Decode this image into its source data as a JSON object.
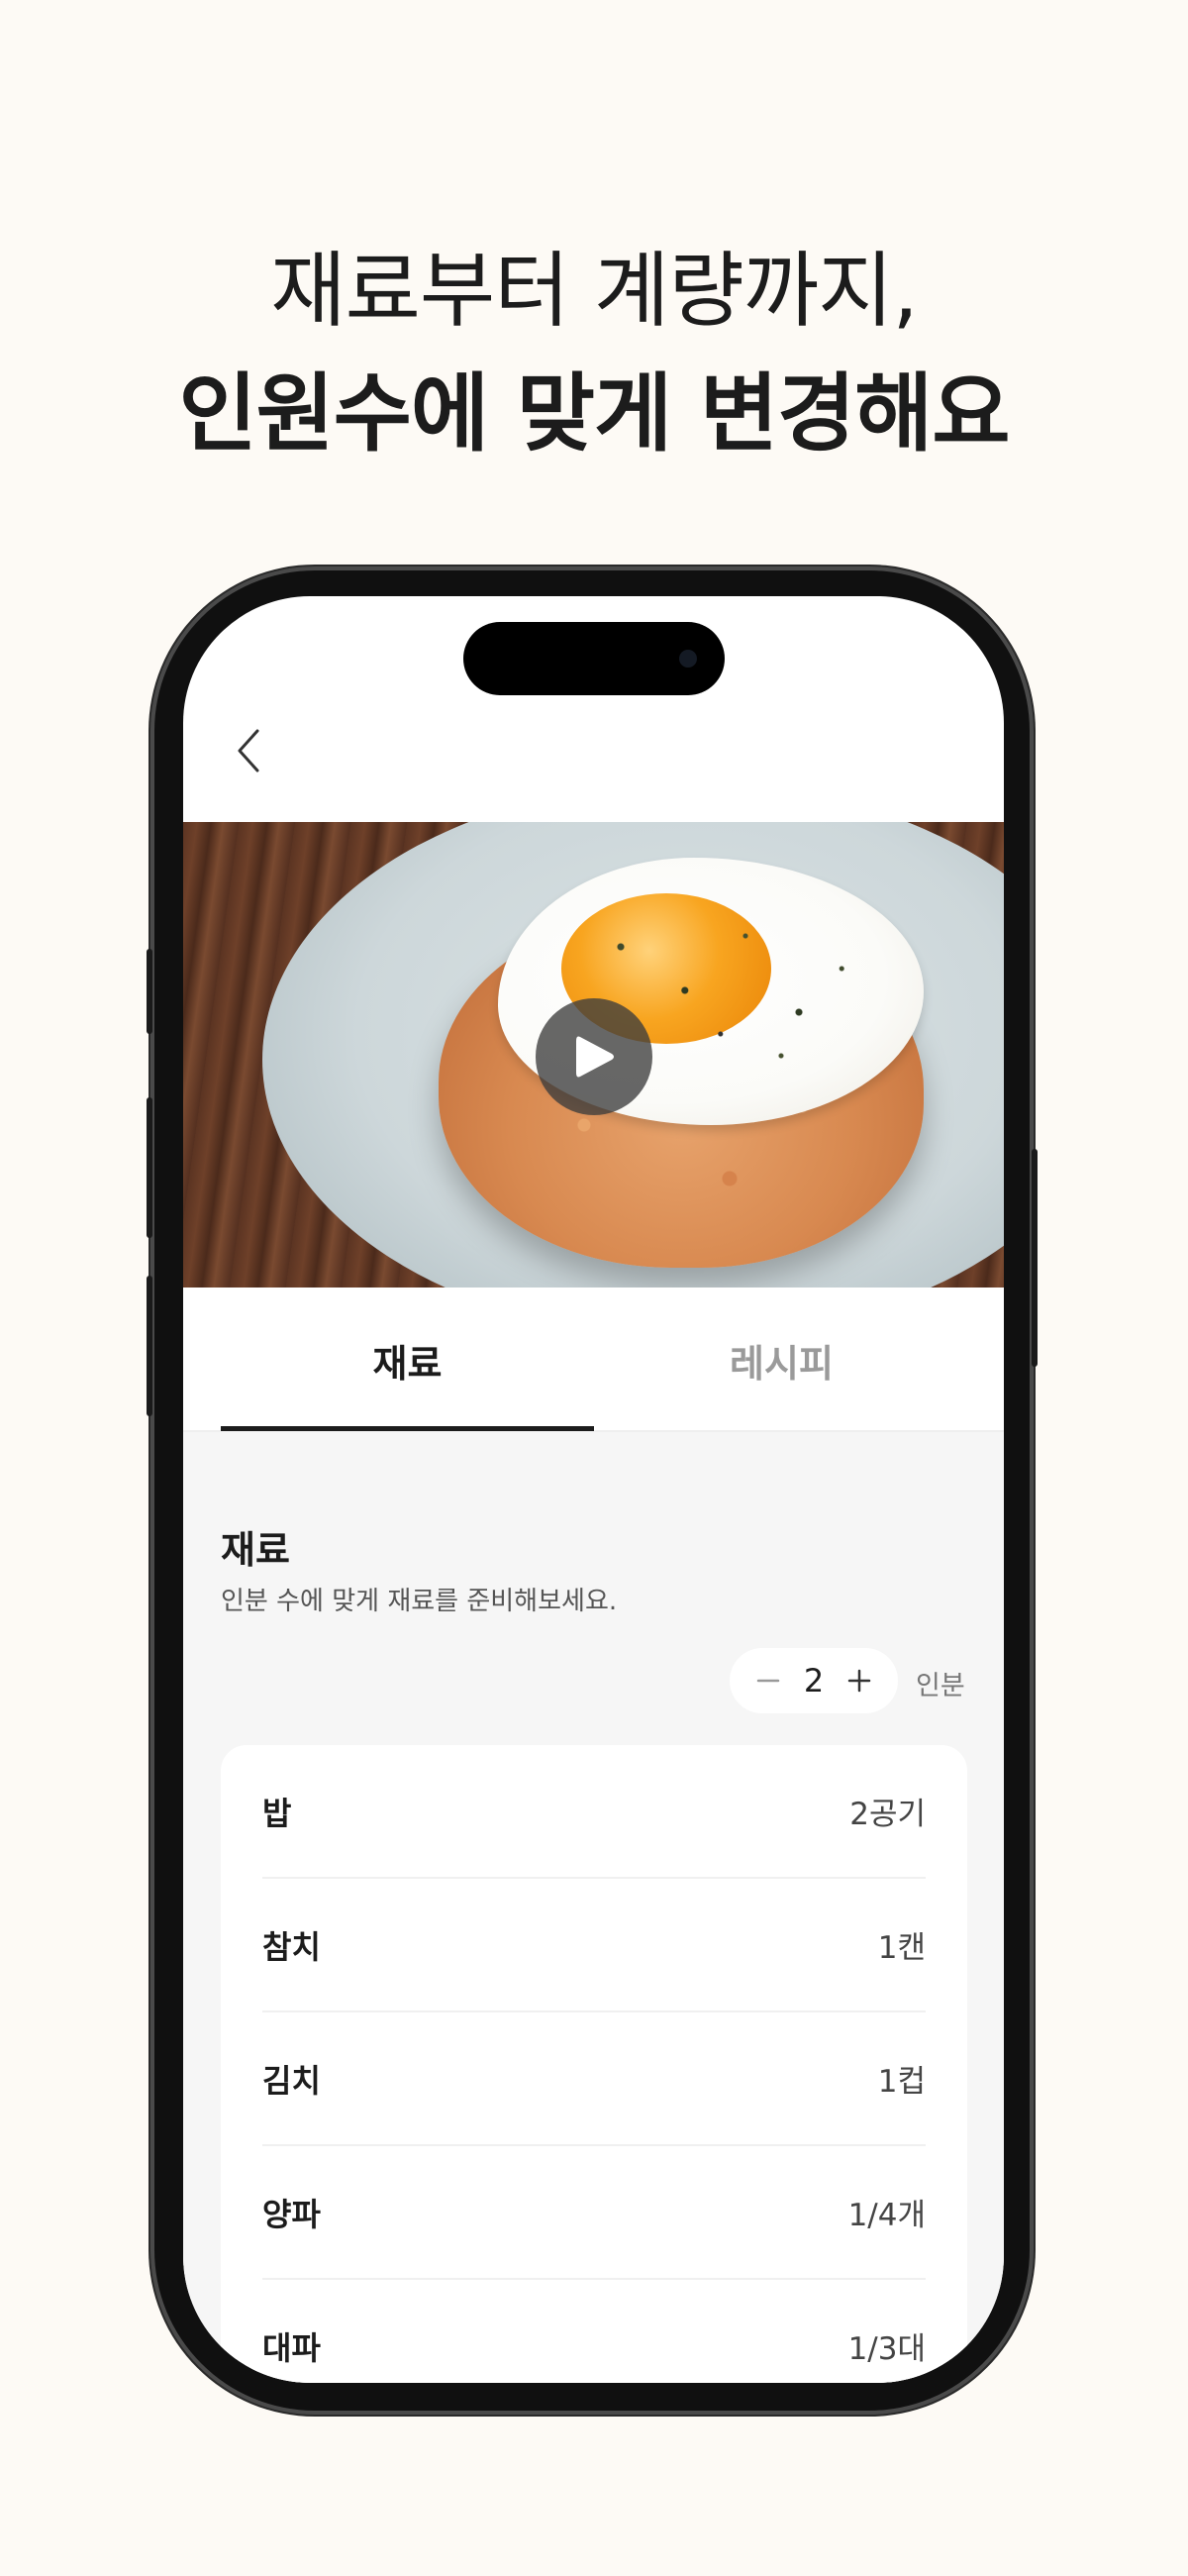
{
  "headline": {
    "line1": "재료부터 계량까지,",
    "line2": "인원수에 맞게 변경해요"
  },
  "tabs": [
    {
      "label": "재료",
      "active": true
    },
    {
      "label": "레시피",
      "active": false
    }
  ],
  "ingredients_section": {
    "title": "재료",
    "description": "인분 수에 맞게 재료를 준비해보세요.",
    "servings": {
      "count": "2",
      "unit": "인분"
    },
    "items": [
      {
        "name": "밥",
        "amount": "2공기"
      },
      {
        "name": "참치",
        "amount": "1캔"
      },
      {
        "name": "김치",
        "amount": "1컵"
      },
      {
        "name": "양파",
        "amount": "1/4개"
      },
      {
        "name": "대파",
        "amount": "1/3대"
      }
    ]
  },
  "icons": {
    "back": "chevron-left-icon",
    "play": "play-icon",
    "minus": "minus-icon",
    "plus": "plus-icon"
  },
  "colors": {
    "background": "#fdfaf5",
    "text_primary": "#1c1c1c",
    "tab_inactive": "#9a9a9a",
    "content_bg": "#f6f6f6"
  }
}
